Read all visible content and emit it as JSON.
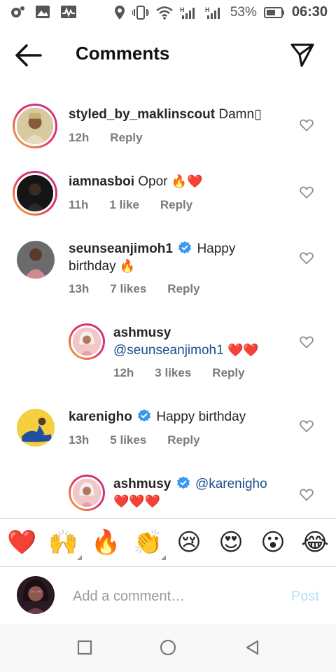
{
  "status_bar": {
    "battery": "53%",
    "time": "06:30",
    "icons": [
      "photo-record-icon",
      "gallery-icon",
      "activity-icon",
      "location-icon",
      "vibrate-icon",
      "wifi-icon",
      "signal-h-icon",
      "signal-h-icon",
      "battery-icon"
    ]
  },
  "header": {
    "title": "Comments",
    "back_icon": "arrow-left-icon",
    "send_icon": "paper-plane-icon"
  },
  "comments": [
    {
      "username": "styled_by_maklinscout",
      "text": "Damn",
      "trailing_glyph": "▯",
      "time": "12h",
      "likes": "",
      "reply": "Reply"
    },
    {
      "username": "iamnasboi",
      "text": "Opor",
      "emojis": "🔥❤️",
      "time": "11h",
      "likes": "1 like",
      "reply": "Reply"
    },
    {
      "username": "seunseanjimoh1",
      "verified": true,
      "text": "Happy birthday",
      "emojis": "🔥",
      "time": "13h",
      "likes": "7 likes",
      "reply": "Reply"
    },
    {
      "username": "ashmusy",
      "mention": "@seunseanjimoh1",
      "emojis": "❤️❤️",
      "time": "12h",
      "likes": "3 likes",
      "reply": "Reply"
    },
    {
      "username": "karenigho",
      "verified": true,
      "text": "Happy birthday",
      "time": "13h",
      "likes": "5 likes",
      "reply": "Reply"
    },
    {
      "username": "ashmusy",
      "verified": true,
      "mention": "@karenigho",
      "emojis": "❤️❤️❤️"
    }
  ],
  "emoji_bar": [
    "❤️",
    "🙌",
    "🔥",
    "👏",
    "😢",
    "😍",
    "😮",
    "😂"
  ],
  "input": {
    "placeholder": "Add a comment…",
    "value": "",
    "post_label": "Post"
  },
  "nav_bar": [
    "square-icon",
    "circle-icon",
    "triangle-back-icon"
  ],
  "colors": {
    "mention": "#1b4e8c",
    "verified": "#3897f0",
    "post_disabled": "#b2dffc",
    "meta": "#7a7a7a"
  }
}
